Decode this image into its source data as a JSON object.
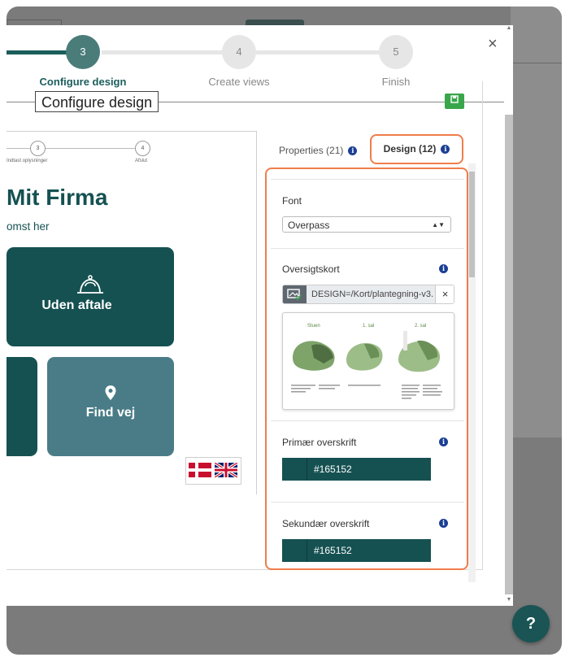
{
  "wizard": {
    "steps": [
      {
        "number": "3",
        "label": "Configure design"
      },
      {
        "number": "4",
        "label": "Create views"
      },
      {
        "number": "5",
        "label": "Finish"
      }
    ],
    "tooltip": "Configure design",
    "accent": "#1b5e5c"
  },
  "preview": {
    "mini_steps": [
      {
        "number": "3",
        "label": "Indtast oplysninger"
      },
      {
        "number": "4",
        "label": "Afslut"
      }
    ],
    "company_name": "Mit Firma",
    "company_sub": "omst her",
    "tiles": [
      {
        "label": "Uden aftale",
        "icon": "reception-bell-icon",
        "color": "#165152"
      },
      {
        "label": "Find vej",
        "icon": "map-pin-icon",
        "color": "#4a7c87"
      }
    ],
    "languages": [
      "da",
      "en"
    ]
  },
  "sidebar": {
    "tabs": [
      {
        "label": "Properties (21)"
      },
      {
        "label": "Design (12)",
        "active": true
      }
    ],
    "font": {
      "label": "Font",
      "value": "Overpass"
    },
    "overview": {
      "label": "Oversigtskort",
      "file": "DESIGN=/Kort/plantegning-v3.",
      "map_labels": [
        "Stuen",
        "1. sal",
        "2. sal"
      ]
    },
    "primary_heading": {
      "label": "Primær overskrift",
      "color": "#165152"
    },
    "secondary_heading": {
      "label": "Sekundær overskrift",
      "color": "#165152"
    }
  },
  "help": {
    "label": "?"
  },
  "colors": {
    "highlight": "#f07d4a",
    "primary": "#165152",
    "tile_secondary": "#4a7c87",
    "save_green": "#3aa64b",
    "info": "#1b3f96"
  }
}
